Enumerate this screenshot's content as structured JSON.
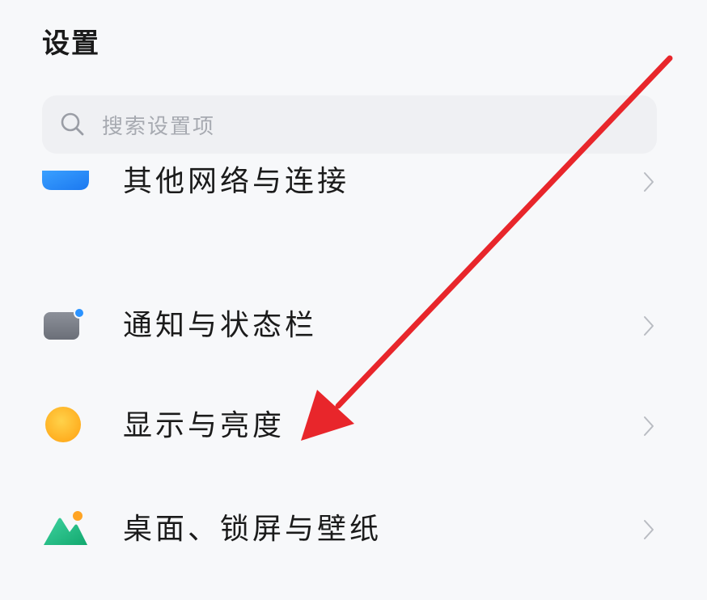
{
  "header": {
    "title": "设置"
  },
  "search": {
    "placeholder": "搜索设置项",
    "icon": "search-icon"
  },
  "settings": {
    "items": [
      {
        "label": "其他网络与连接",
        "icon": "network-connection-icon"
      },
      {
        "label": "通知与状态栏",
        "icon": "notification-statusbar-icon"
      },
      {
        "label": "显示与亮度",
        "icon": "display-brightness-icon"
      },
      {
        "label": "桌面、锁屏与壁纸",
        "icon": "wallpaper-icon"
      }
    ]
  },
  "annotation": {
    "arrow_color": "#e8262b",
    "points_to": "显示与亮度"
  }
}
